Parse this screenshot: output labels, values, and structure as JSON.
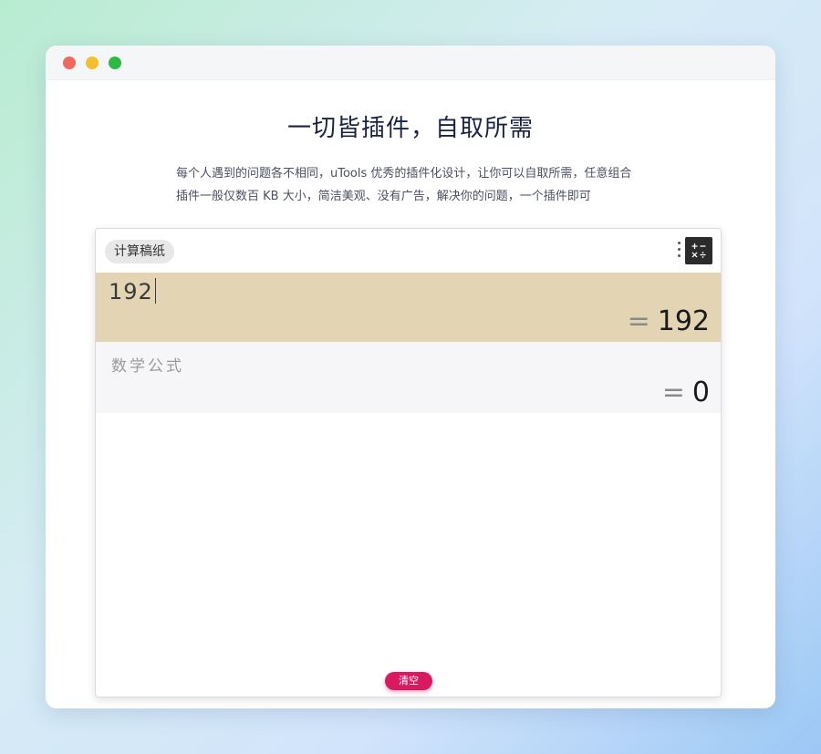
{
  "window": {
    "controls": [
      "close",
      "minimize",
      "maximize"
    ]
  },
  "page": {
    "heading": "一切皆插件，自取所需",
    "subtitle_line1": "每个人遇到的问题各不相同，uTools 优秀的插件化设计，让你可以自取所需，任意组合",
    "subtitle_line2": "插件一般仅数百 KB 大小，简洁美观、没有广告，解决你的问题，一个插件即可"
  },
  "plugin": {
    "tag_label": "计算稿纸",
    "menu_icon": "kebab-menu-icon",
    "calc_icon": "calculator-icon",
    "rows": [
      {
        "expression": "192",
        "equals": "=",
        "result": "192",
        "active": true
      },
      {
        "placeholder": "数学公式",
        "equals": "=",
        "result": "0",
        "active": false
      }
    ],
    "clear_label": "清空"
  },
  "colors": {
    "active_row": "#e3d5b3",
    "inactive_row": "#f6f6f8",
    "clear_button": "#d81b60",
    "close_dot": "#ec6a5e",
    "minimize_dot": "#f4bf2e",
    "maximize_dot": "#2fb845"
  }
}
